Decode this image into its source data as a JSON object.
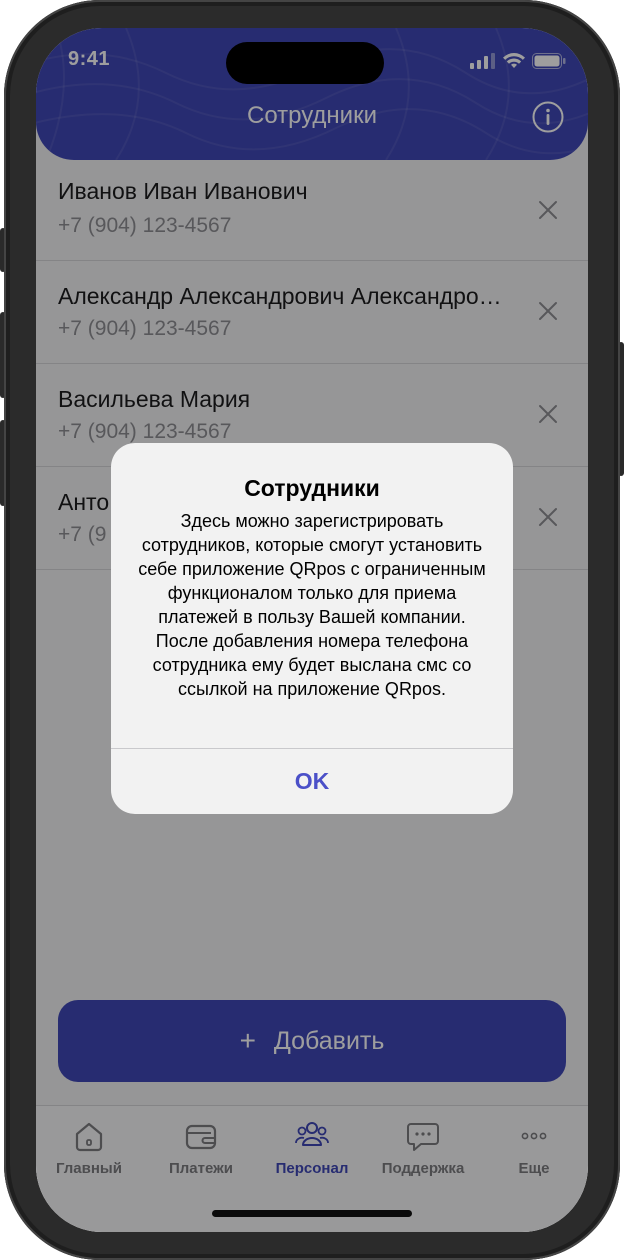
{
  "status": {
    "time": "9:41"
  },
  "header": {
    "title": "Сотрудники"
  },
  "employees": [
    {
      "name": "Иванов Иван Иванович",
      "phone": "+7 (904) 123-4567"
    },
    {
      "name": "Александр Александрович Александрович",
      "phone": "+7 (904) 123-4567"
    },
    {
      "name": "Васильева Мария",
      "phone": "+7 (904) 123-4567"
    },
    {
      "name": "Анто",
      "phone": "+7 (9"
    }
  ],
  "add_button": {
    "label": "Добавить"
  },
  "tabs": [
    {
      "label": "Главный",
      "icon": "home-icon"
    },
    {
      "label": "Платежи",
      "icon": "wallet-icon"
    },
    {
      "label": "Персонал",
      "icon": "users-icon",
      "active": true
    },
    {
      "label": "Поддержка",
      "icon": "chat-icon"
    },
    {
      "label": "Еще",
      "icon": "more-icon"
    }
  ],
  "alert": {
    "title": "Сотрудники",
    "message": "Здесь можно зарегистрировать сотрудников, которые смогут установить себе приложение QRpos с ограниченным функционалом только для приема платежей в пользу Вашей компании. После добавления номера телефона сотрудника ему будет выслана смс со ссылкой на приложение QRpos.",
    "ok_label": "OK"
  },
  "colors": {
    "brand": "#3f47b7",
    "alert_button": "#4b50c8",
    "muted_text": "#8e8e93"
  }
}
